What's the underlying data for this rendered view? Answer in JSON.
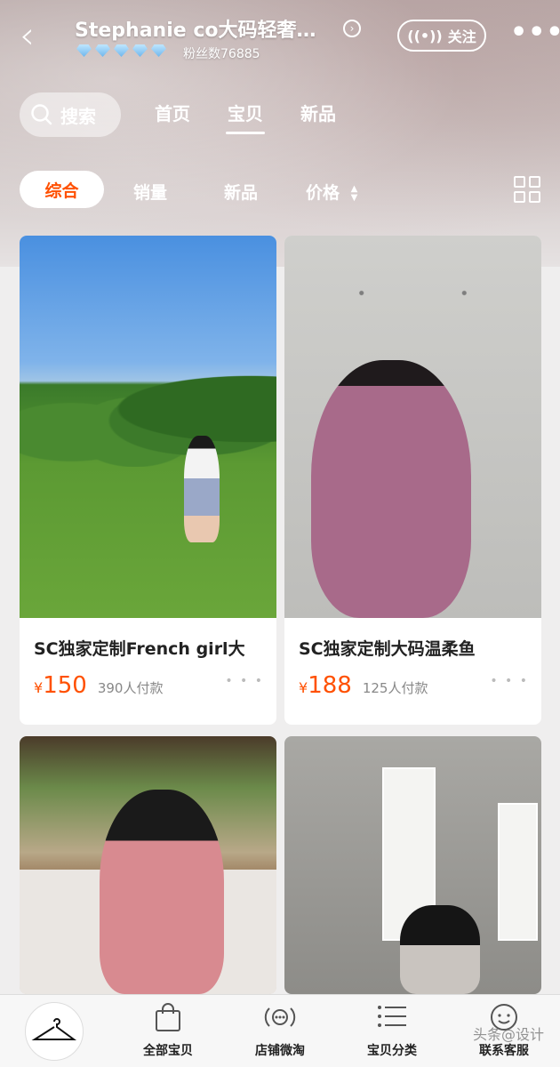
{
  "header": {
    "store_name": "Stephanie co大码轻奢…",
    "fans_label": "粉丝数76885",
    "follow_label": "关注",
    "diamond_count": 5
  },
  "nav": {
    "search_label": "搜索",
    "tabs": [
      {
        "label": "首页",
        "active": false
      },
      {
        "label": "宝贝",
        "active": true
      },
      {
        "label": "新品",
        "active": false
      }
    ]
  },
  "sort": {
    "active": "综合",
    "items": [
      "销量",
      "新品",
      "价格"
    ]
  },
  "products": [
    {
      "title": "SC独家定制French girl大",
      "price_symbol": "¥",
      "price": "150",
      "sold": "390人付款"
    },
    {
      "title": "SC独家定制大码温柔鱼",
      "price_symbol": "¥",
      "price": "188",
      "sold": "125人付款"
    },
    {
      "title": "",
      "price_symbol": "",
      "price": "",
      "sold": ""
    },
    {
      "title": "",
      "price_symbol": "",
      "price": "",
      "sold": ""
    }
  ],
  "tabbar": {
    "items": [
      "全部宝贝",
      "店铺微淘",
      "宝贝分类",
      "联系客服"
    ]
  },
  "watermark": "头条@设计"
}
